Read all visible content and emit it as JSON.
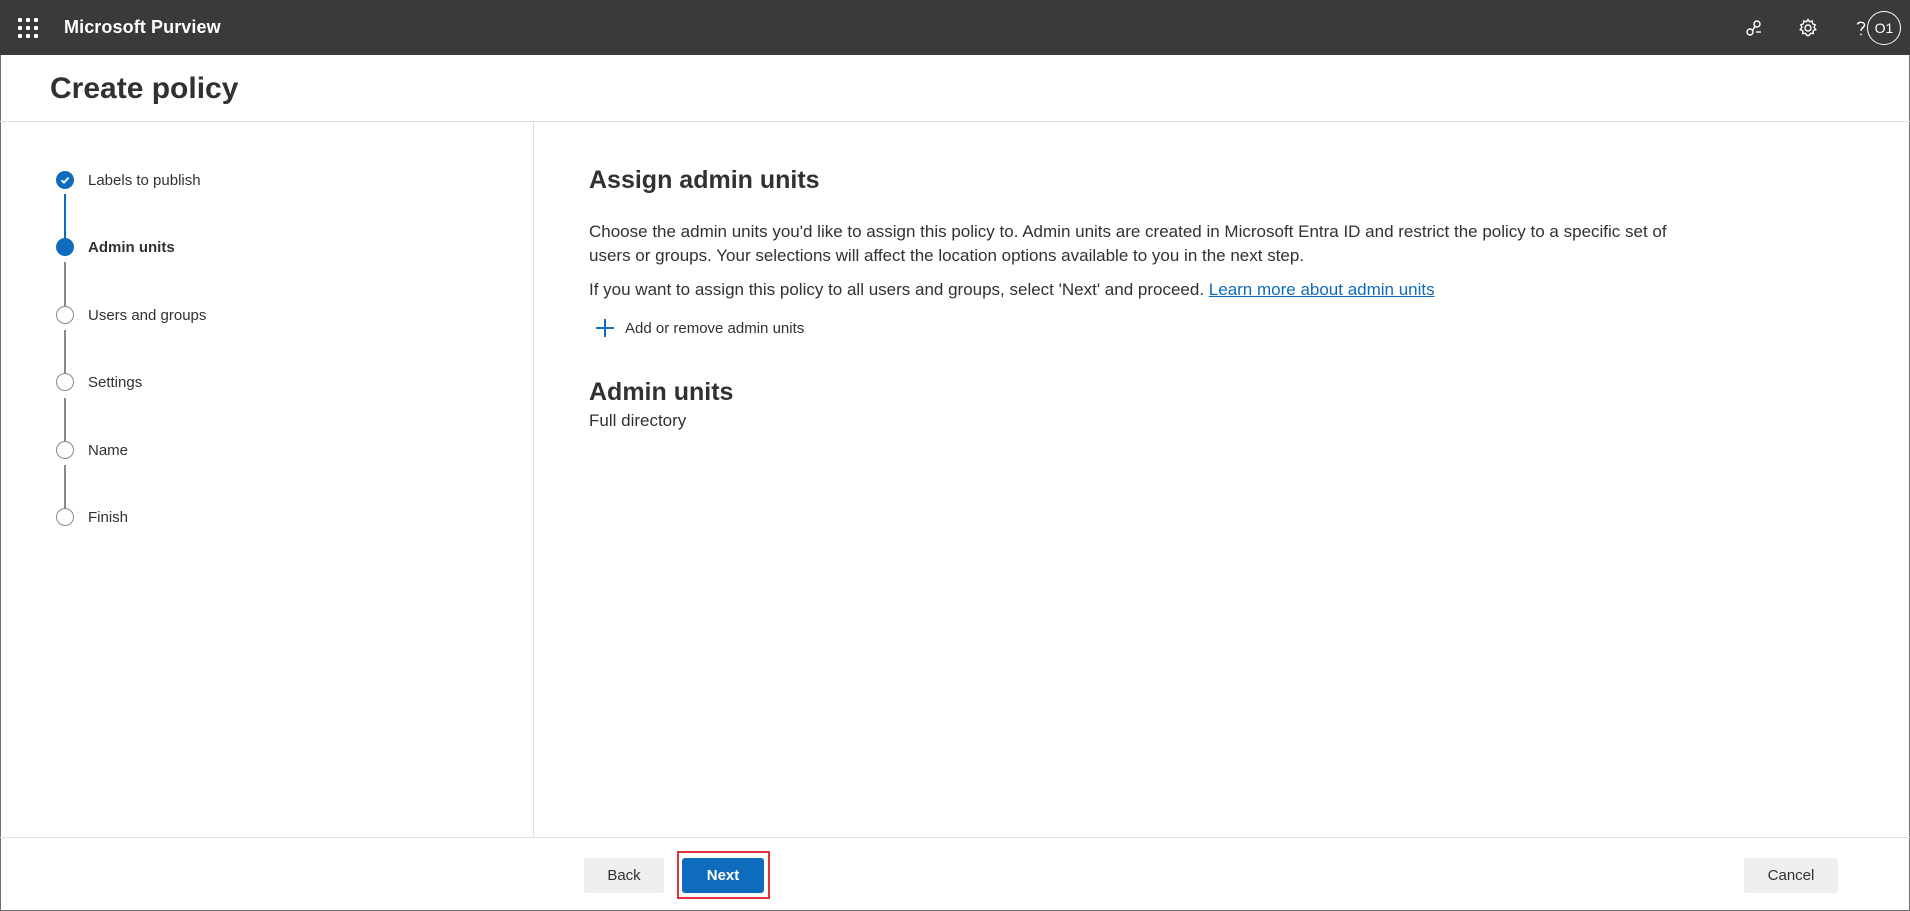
{
  "app": {
    "title": "Microsoft Purview",
    "avatar_initials": "O1",
    "icons": [
      "app-launcher-icon",
      "connections-icon",
      "settings-gear-icon",
      "help-question-icon"
    ]
  },
  "page": {
    "title": "Create policy"
  },
  "steps": [
    {
      "label": "Labels to publish",
      "state": "completed"
    },
    {
      "label": "Admin units",
      "state": "current"
    },
    {
      "label": "Users and groups",
      "state": "pending"
    },
    {
      "label": "Settings",
      "state": "pending"
    },
    {
      "label": "Name",
      "state": "pending"
    },
    {
      "label": "Finish",
      "state": "pending"
    }
  ],
  "main": {
    "heading": "Assign admin units",
    "description": "Choose the admin units you'd like to assign this policy to. Admin units are created in Microsoft Entra ID and restrict the policy to a specific set of users or groups. Your selections will affect the location options available to you in the next step.",
    "all_users_text": "If you want to assign this policy to all users and groups, select 'Next' and proceed.",
    "learn_more_link": "Learn more about admin units",
    "add_remove_label": "Add or remove admin units",
    "admin_units_heading": "Admin units",
    "admin_units_value": "Full directory"
  },
  "footer": {
    "back_label": "Back",
    "next_label": "Next",
    "cancel_label": "Cancel"
  },
  "colors": {
    "topbar": "#3b3a39",
    "accent": "#0f6cbd",
    "highlight_box": "#e0323a"
  }
}
